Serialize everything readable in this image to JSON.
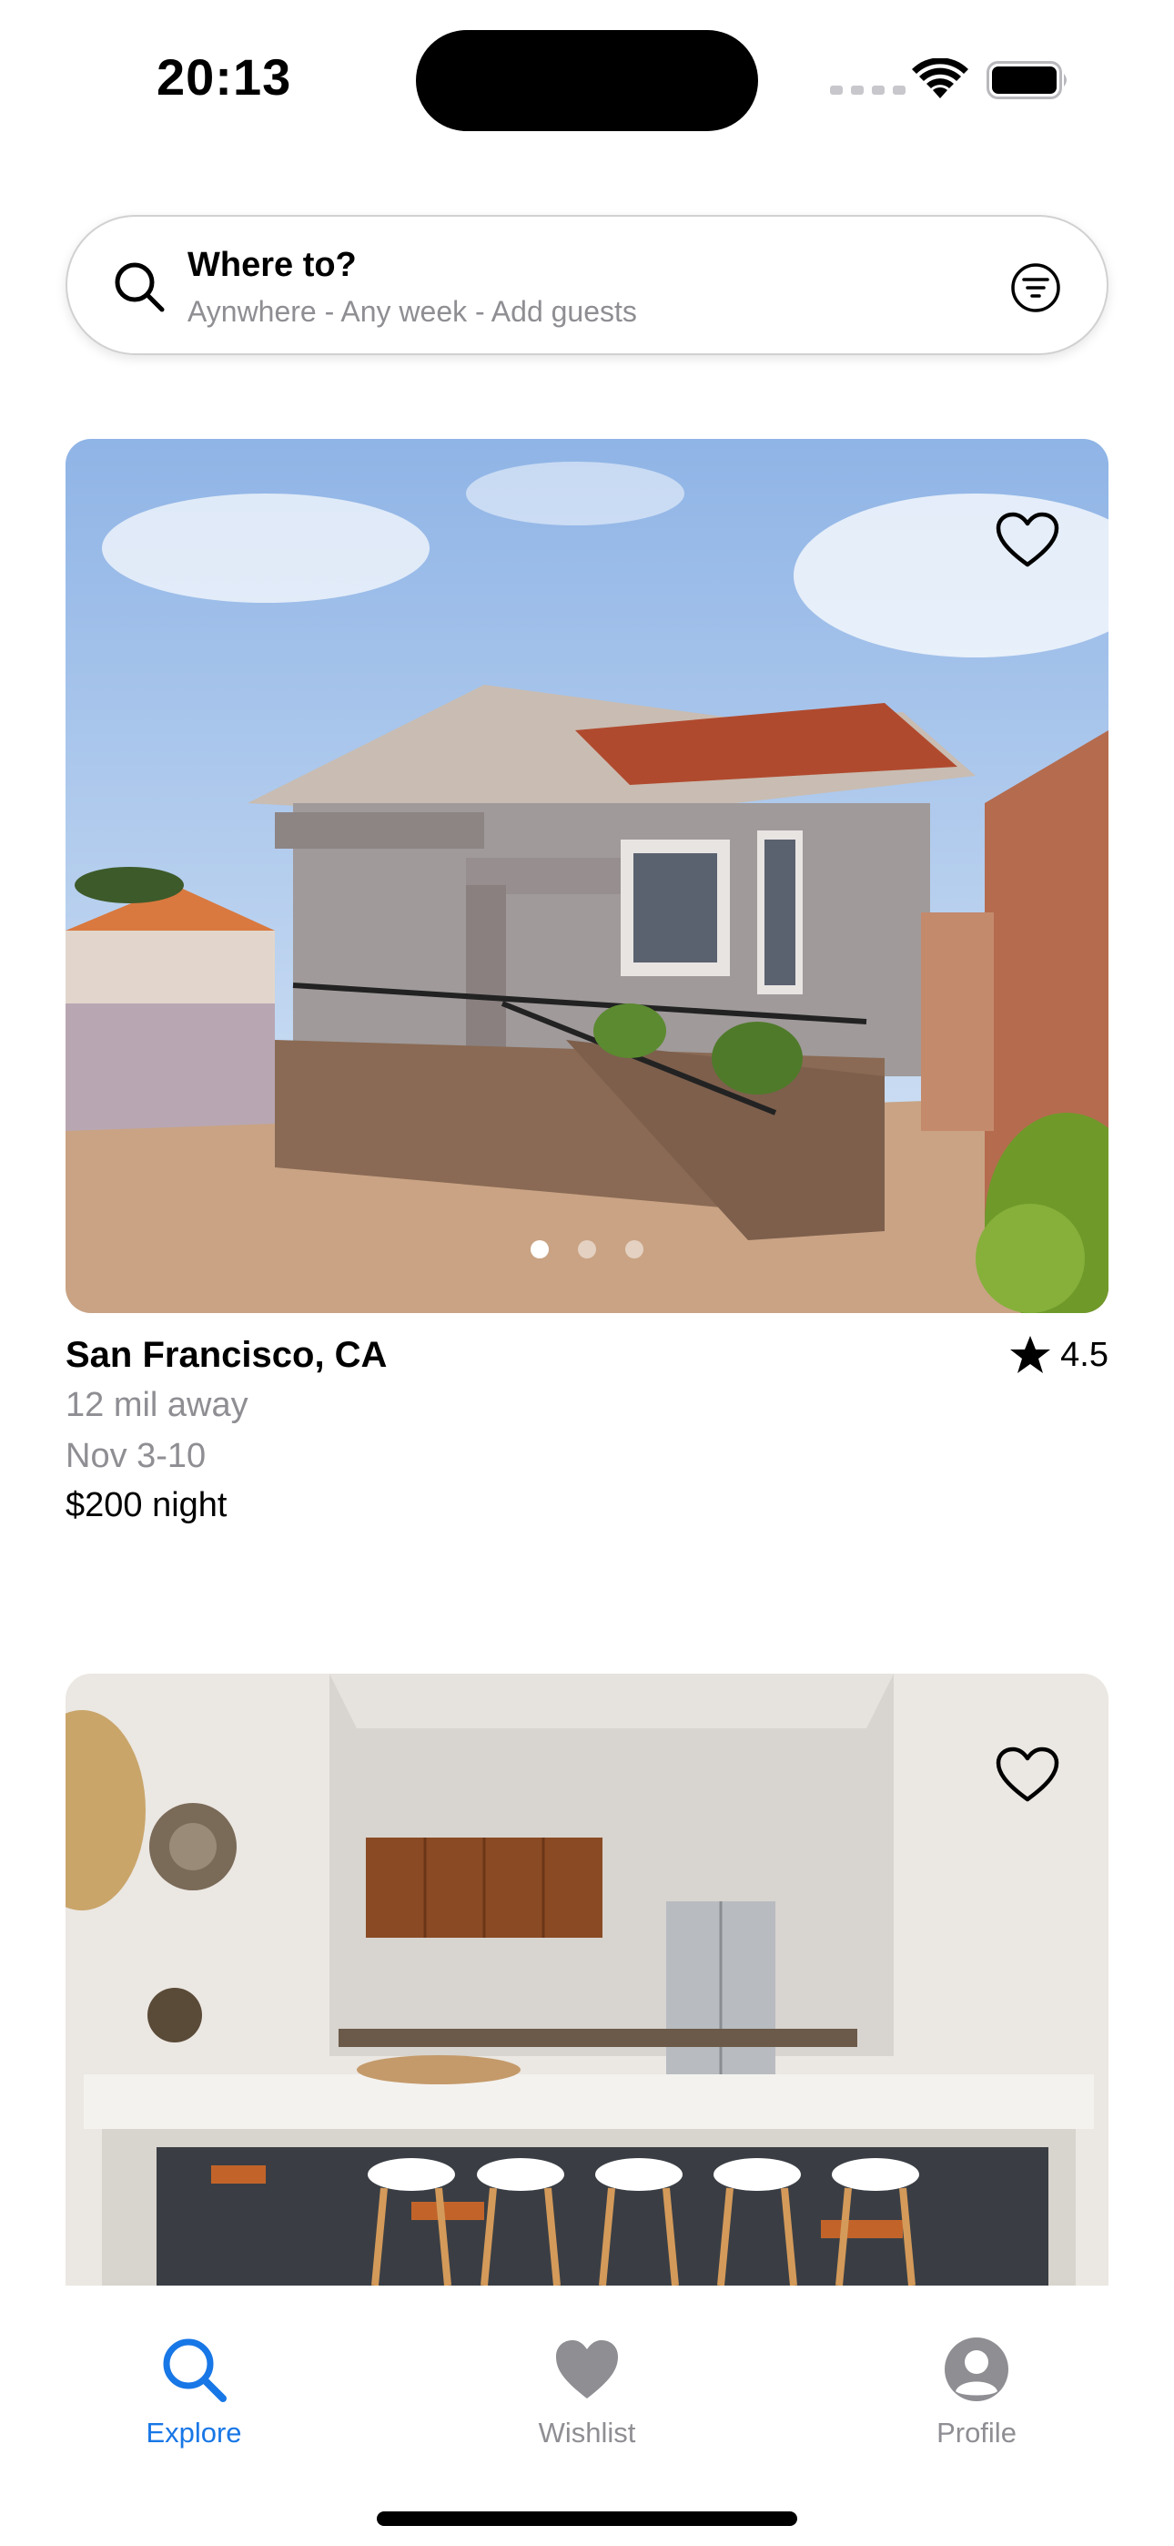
{
  "status_bar": {
    "time": "20:13"
  },
  "search": {
    "title": "Where to?",
    "subtitle": "Aynwhere - Any week - Add guests",
    "icon": "search-icon",
    "filter_icon": "filter-icon"
  },
  "listings": [
    {
      "location": "San Francisco, CA",
      "rating": "4.5",
      "distance": "12 mil away",
      "dates": "Nov 3-10",
      "price": "$200 night",
      "photo": "house exterior",
      "photo_count": 3,
      "active_photo": 1
    },
    {
      "photo": "kitchen interior"
    }
  ],
  "tab_bar": {
    "tabs": [
      {
        "label": "Explore",
        "icon": "search-icon",
        "active": true
      },
      {
        "label": "Wishlist",
        "icon": "heart-icon",
        "active": false
      },
      {
        "label": "Profile",
        "icon": "profile-icon",
        "active": false
      }
    ]
  },
  "colors": {
    "accent": "#1877e6",
    "secondary_text": "#8e8e93",
    "tab_inactive": "#8e8e93"
  }
}
